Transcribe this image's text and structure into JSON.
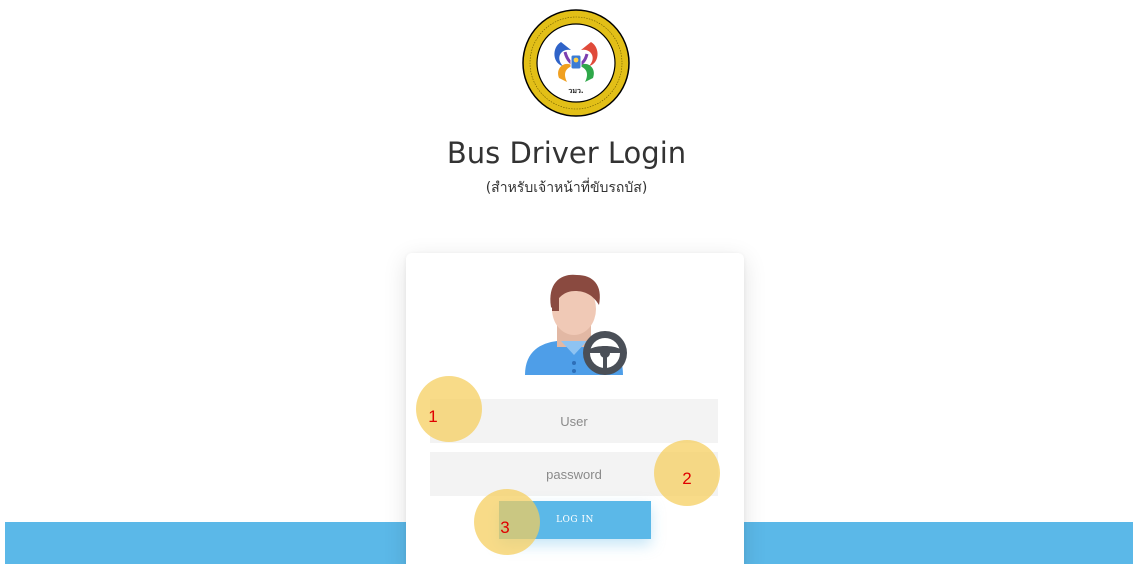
{
  "header": {
    "title": "Bus Driver Login",
    "subtitle": "(สำหรับเจ้าหน้าที่ขับรถบัส)",
    "logo_text": "วมว."
  },
  "login": {
    "user_placeholder": "User",
    "password_placeholder": "password",
    "login_label": "LOG IN",
    "avatar_icon": "bus-driver-avatar-icon"
  },
  "annotations": [
    "1",
    "2",
    "3"
  ],
  "colors": {
    "accent": "#5bb8e8",
    "field_bg": "#f3f3f3",
    "marker": "#f5cd5a",
    "marker_text": "#e00000",
    "logo_ring": "#d7b300"
  }
}
